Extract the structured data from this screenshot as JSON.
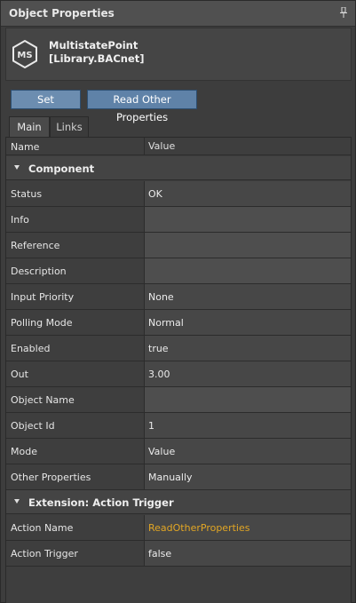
{
  "window": {
    "title": "Object Properties",
    "pin_icon": "pin-icon"
  },
  "object": {
    "logo_text": "MS",
    "name_line1": "MultistatePoint",
    "name_line2": "[Library.BACnet]"
  },
  "toolbar": {
    "set_label": "Set",
    "read_label": "Read Other Properties"
  },
  "tabs": [
    {
      "label": "Main",
      "active": true
    },
    {
      "label": "Links",
      "active": false
    }
  ],
  "grid": {
    "col_name": "Name",
    "col_value": "Value",
    "sections": [
      {
        "title": "Component",
        "rows": [
          {
            "name": "Status",
            "value": "OK"
          },
          {
            "name": "Info",
            "value": ""
          },
          {
            "name": "Reference",
            "value": ""
          },
          {
            "name": "Description",
            "value": ""
          },
          {
            "name": "Input Priority",
            "value": "None"
          },
          {
            "name": "Polling Mode",
            "value": "Normal"
          },
          {
            "name": "Enabled",
            "value": "true"
          },
          {
            "name": "Out",
            "value": "3.00"
          },
          {
            "name": "Object Name",
            "value": ""
          },
          {
            "name": "Object Id",
            "value": "1"
          },
          {
            "name": "Mode",
            "value": "Value"
          },
          {
            "name": "Other Properties",
            "value": "Manually"
          }
        ]
      },
      {
        "title": "Extension: Action Trigger",
        "rows": [
          {
            "name": "Action Name",
            "value": "ReadOtherProperties"
          },
          {
            "name": "Action Trigger",
            "value": "false"
          }
        ]
      }
    ]
  },
  "colors": {
    "accent_button": "#6c8db0",
    "link_value": "#e2a624"
  }
}
